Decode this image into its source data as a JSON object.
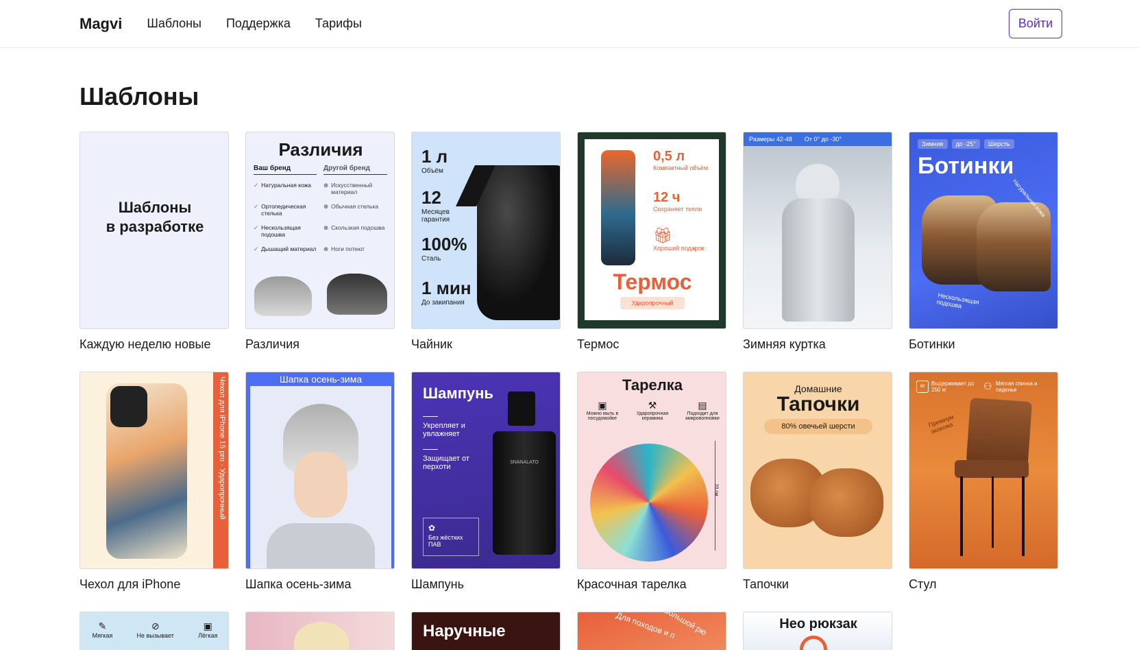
{
  "header": {
    "logo": "Magvi",
    "nav": [
      "Шаблоны",
      "Поддержка",
      "Тарифы"
    ],
    "login": "Войти"
  },
  "page_title": "Шаблоны",
  "cards": [
    {
      "caption": "Каждую неделю новые",
      "placeholder_line1": "Шаблоны",
      "placeholder_line2": "в разработке"
    },
    {
      "caption": "Различия",
      "heading": "Различия",
      "col_left": "Ваш бренд",
      "col_right": "Другой бренд",
      "left_items": [
        "Натуральная кожа",
        "Ортопедическая стелька",
        "Нескользящая подошва",
        "Дышащий материал"
      ],
      "right_items": [
        "Искусственный материал",
        "Обычная стелька",
        "Скользкая подошва",
        "Ноги потеют"
      ]
    },
    {
      "caption": "Чайник",
      "stats": [
        {
          "v": "1 л",
          "l": "Объём"
        },
        {
          "v": "12",
          "l": "Месяцев гарантия"
        },
        {
          "v": "100%",
          "l": "Сталь"
        },
        {
          "v": "1 мин",
          "l": "До закипания"
        }
      ]
    },
    {
      "caption": "Термос",
      "stats": [
        {
          "v": "0,5 л",
          "l": "Компактный объём"
        },
        {
          "v": "12 ч",
          "l": "Сохраняет тепло"
        },
        {
          "v": "",
          "l": "Хороший подарок"
        }
      ],
      "title": "Термос",
      "badge": "Ударопрочный"
    },
    {
      "caption": "Зимняя куртка",
      "tag1": "Размеры 42-48",
      "tag2": "От 0° до -30°"
    },
    {
      "caption": "Ботинки",
      "tags": [
        "Зимние",
        "до -25°",
        "Шерсть"
      ],
      "title": "Ботинки",
      "note1": "Натуральная кожа",
      "note2": "Нескользящая подошва"
    },
    {
      "caption": "Чехол для iPhone",
      "side_text": "Чехол для iPhone 15 pro · Ударопрочный"
    },
    {
      "caption": "Шапка осень-зима",
      "banner": "Шапка осень-зима"
    },
    {
      "caption": "Шампунь",
      "title": "Шампунь",
      "line1": "Укрепляет и увлажняет",
      "line2": "Защищает от перхоти",
      "box": "Без жёстких ПАВ",
      "brand": "SNANALATO"
    },
    {
      "caption": "Красочная тарелка",
      "title": "Тарелка",
      "features": [
        "Можно мыть в посудомойке",
        "Ударопрочная керамика",
        "Подходит для микроволновки"
      ],
      "size": "20 см"
    },
    {
      "caption": "Тапочки",
      "sub": "Домашние",
      "title": "Тапочки",
      "badge": "80% овечьей шерсти"
    },
    {
      "caption": "Стул",
      "feat1": "Выдерживает до 250 кг",
      "feat2": "Мягкая спинка и сиденье",
      "note": "Премиум экокожа",
      "badge_num": "60"
    }
  ],
  "row3": [
    {
      "labels": [
        "Мягкая",
        "Не вызывает",
        "Лёгкая"
      ]
    },
    {},
    {
      "title": "Наручные"
    },
    {
      "text1": "Для походов и п",
      "text2": "Большой рю"
    },
    {
      "title": "Нео рюкзак"
    }
  ],
  "colors": {
    "accent": "#5b2bd6",
    "orange": "#e8603a",
    "blue": "#3b5bdb"
  }
}
